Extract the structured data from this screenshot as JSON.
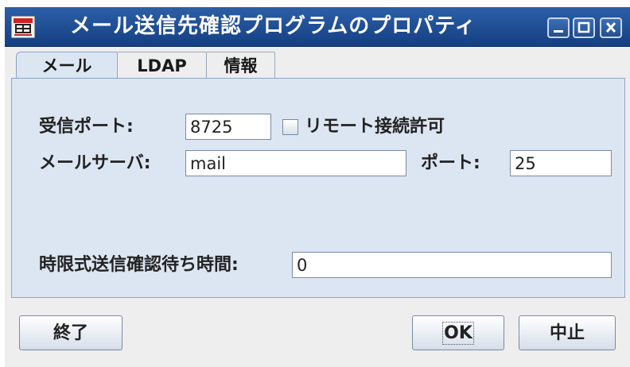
{
  "window": {
    "title": "メール送信先確認プログラムのプロパティ"
  },
  "tabs": [
    {
      "label": "メール",
      "selected": true
    },
    {
      "label": "LDAP",
      "selected": false
    },
    {
      "label": "情報",
      "selected": false
    }
  ],
  "form": {
    "receive_port_label": "受信ポート:",
    "receive_port_value": "8725",
    "remote_connect_label": "リモート接続許可",
    "remote_connect_checked": false,
    "mail_server_label": "メールサーバ:",
    "mail_server_value": "mail",
    "port_label": "ポート:",
    "port_value": "25",
    "timeout_label": "時限式送信確認待ち時間:",
    "timeout_value": "0"
  },
  "buttons": {
    "exit": "終了",
    "ok": "OK",
    "cancel": "中止"
  },
  "colors": {
    "titlebar": "#1f4e96",
    "panel": "#dce6f2",
    "window_bg": "#eeeeee"
  }
}
